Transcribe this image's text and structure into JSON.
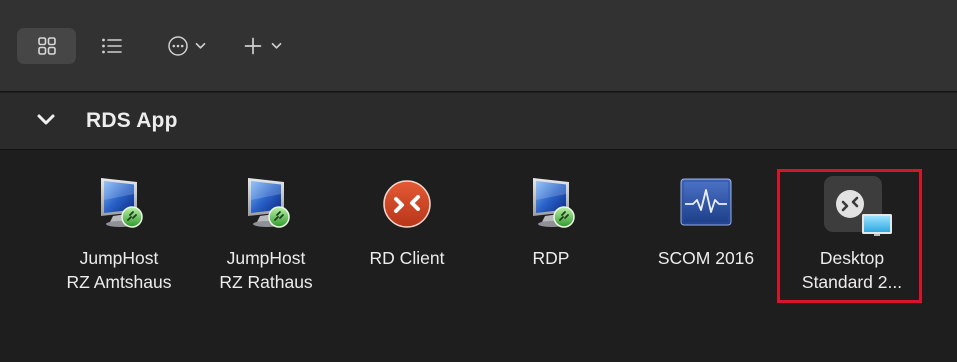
{
  "toolbar": {
    "buttons": [
      {
        "icon": "grid-view-icon"
      },
      {
        "icon": "list-view-icon"
      },
      {
        "icon": "more-options-icon"
      },
      {
        "icon": "add-icon"
      }
    ]
  },
  "section": {
    "title": "RDS App"
  },
  "tiles": [
    {
      "line1": "JumpHost",
      "line2": "RZ Amtshaus",
      "icon": "rdp-monitor-icon"
    },
    {
      "line1": "JumpHost",
      "line2": "RZ Rathaus",
      "icon": "rdp-monitor-icon"
    },
    {
      "line1": "RD Client",
      "line2": "",
      "icon": "rd-client-icon"
    },
    {
      "line1": "RDP",
      "line2": "",
      "icon": "rdp-monitor-icon"
    },
    {
      "line1": "SCOM 2016",
      "line2": "",
      "icon": "scom-icon"
    },
    {
      "line1": "Desktop",
      "line2": "Standard 2...",
      "icon": "desktop-connection-icon",
      "selected": true
    }
  ],
  "colors": {
    "selection": "#d4162c",
    "toolbar": "#323232",
    "header": "#2b2b2b",
    "background": "#1e1e1e"
  }
}
